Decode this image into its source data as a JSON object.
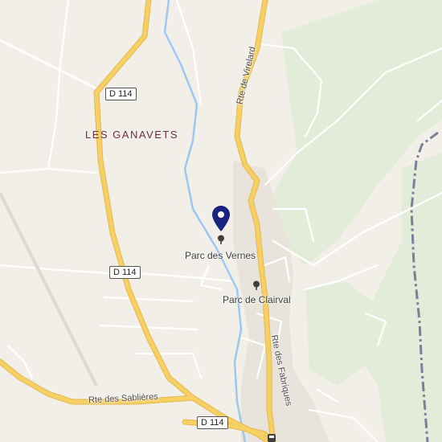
{
  "map": {
    "place_label": "LES GANAVETS",
    "pois": [
      {
        "id": "parc-des-vernes",
        "label": "Parc des Vernes",
        "icon": "park-tree-icon"
      },
      {
        "id": "parc-de-clairval",
        "label": "Parc de Clairval",
        "icon": "park-tree-icon"
      }
    ],
    "roads": {
      "rte_de_virelard": "Rte de Virelard",
      "rte_des_fabriques": "Rte des Fabriques",
      "rte_des_sablieres": "Rte des Sablières"
    },
    "shields": [
      "D 114",
      "D 114",
      "D 114"
    ],
    "marker": {
      "icon": "location-pin-icon",
      "color": "#1a237e"
    },
    "colors": {
      "land": "#f2efe9",
      "forest": "#e3ebd9",
      "major_road": "#f6cf65",
      "road_casing": "#e5b94d",
      "minor_road": "#ffffff",
      "river": "#9ec7f0",
      "railway": "#7a7f9a",
      "built_area": "#e2ded6",
      "place_label": "#6b2f3e"
    }
  }
}
